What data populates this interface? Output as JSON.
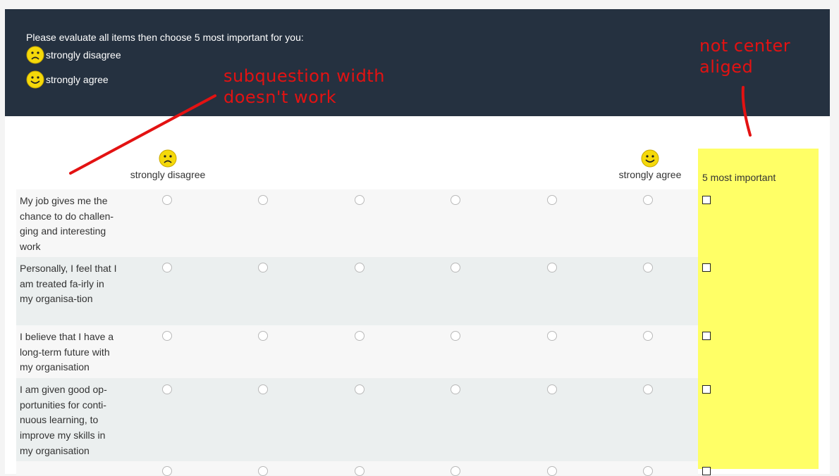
{
  "question": {
    "text": "Please evaluate all items then choose 5 most important for you:",
    "legend": [
      {
        "icon": "sad-face-icon",
        "label": "strongly disagree"
      },
      {
        "icon": "happy-face-icon",
        "label": "strongly agree"
      }
    ]
  },
  "columns": {
    "left_label": "strongly disagree",
    "right_label": "strongly agree",
    "most_important_label": "5 most important",
    "scale_points": 6
  },
  "rows": [
    {
      "text": "My job gives me the chance to do challen-ging and interesting work"
    },
    {
      "text": "Personally, I feel that I am treated fa-irly in my organisa-tion"
    },
    {
      "text": "I believe that I have a long-term future with my organisation"
    },
    {
      "text": "I am given good op-portunities for conti-nuous learning, to improve my skills in my organisation"
    }
  ],
  "annotations": {
    "subquestion": "subquestion width\ndoesn't work",
    "center": "not center\naliged"
  },
  "colors": {
    "header_bg": "#253140",
    "highlight_col": "#ffff66",
    "annotation": "#e31212"
  }
}
